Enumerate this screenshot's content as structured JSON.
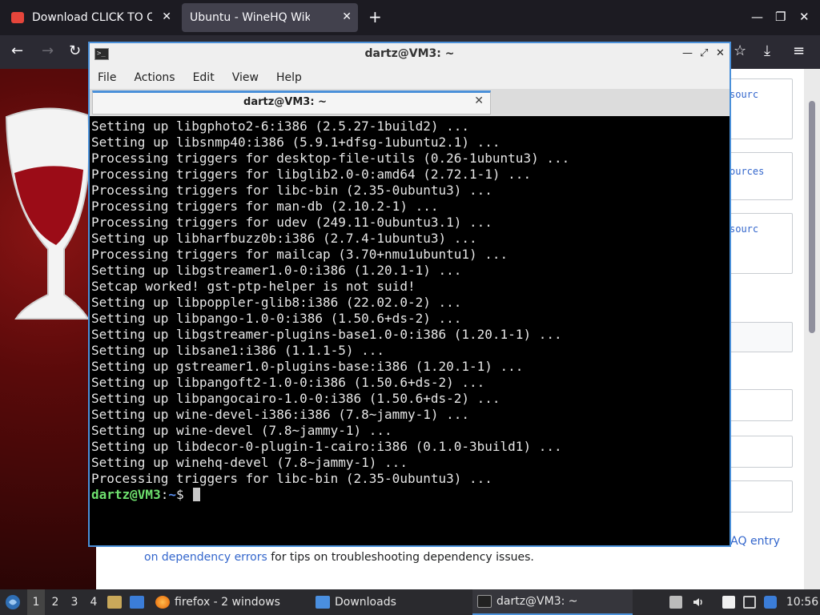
{
  "browser": {
    "tabs": [
      {
        "title": "Download CLICK TO CON",
        "active": false
      },
      {
        "title": "Ubuntu - WineHQ Wiki",
        "active": true
      }
    ],
    "new_tab": "+",
    "controls": {
      "minimize": "—",
      "maximize": "❐",
      "close": "✕"
    },
    "nav": {
      "back": "←",
      "forward": "→",
      "reload": "↻",
      "bookmark": "☆",
      "downloads": "⤓",
      "menu": "≡"
    }
  },
  "wiki": {
    "links": [
      "sourc",
      "ources",
      "sourc"
    ],
    "footer_text_pre": "",
    "footer_link_1": "FAQ entry",
    "footer_link_2": "on dependency errors",
    "footer_text_post": " for tips on troubleshooting dependency issues."
  },
  "terminal": {
    "title": "dartz@VM3: ~",
    "title_icon": ">_",
    "controls": {
      "minimize": "—",
      "maximize": "⤢",
      "close": "✕"
    },
    "menu": [
      "File",
      "Actions",
      "Edit",
      "View",
      "Help"
    ],
    "tab_label": "dartz@VM3: ~",
    "tab_close": "✕",
    "lines": [
      "Setting up libgphoto2-6:i386 (2.5.27-1build2) ...",
      "Setting up libsnmp40:i386 (5.9.1+dfsg-1ubuntu2.1) ...",
      "Processing triggers for desktop-file-utils (0.26-1ubuntu3) ...",
      "Processing triggers for libglib2.0-0:amd64 (2.72.1-1) ...",
      "Processing triggers for libc-bin (2.35-0ubuntu3) ...",
      "Processing triggers for man-db (2.10.2-1) ...",
      "Processing triggers for udev (249.11-0ubuntu3.1) ...",
      "Setting up libharfbuzz0b:i386 (2.7.4-1ubuntu3) ...",
      "Processing triggers for mailcap (3.70+nmu1ubuntu1) ...",
      "Setting up libgstreamer1.0-0:i386 (1.20.1-1) ...",
      "Setcap worked! gst-ptp-helper is not suid!",
      "Setting up libpoppler-glib8:i386 (22.02.0-2) ...",
      "Setting up libpango-1.0-0:i386 (1.50.6+ds-2) ...",
      "Setting up libgstreamer-plugins-base1.0-0:i386 (1.20.1-1) ...",
      "Setting up libsane1:i386 (1.1.1-5) ...",
      "Setting up gstreamer1.0-plugins-base:i386 (1.20.1-1) ...",
      "Setting up libpangoft2-1.0-0:i386 (1.50.6+ds-2) ...",
      "Setting up libpangocairo-1.0-0:i386 (1.50.6+ds-2) ...",
      "Setting up wine-devel-i386:i386 (7.8~jammy-1) ...",
      "Setting up wine-devel (7.8~jammy-1) ...",
      "Setting up libdecor-0-plugin-1-cairo:i386 (0.1.0-3build1) ...",
      "Setting up winehq-devel (7.8~jammy-1) ...",
      "Processing triggers for libc-bin (2.35-0ubuntu3) ..."
    ],
    "prompt_user": "dartz@VM3",
    "prompt_sep": ":",
    "prompt_path": "~",
    "prompt_sym": "$ "
  },
  "taskbar": {
    "workspaces": [
      "1",
      "2",
      "3",
      "4"
    ],
    "tasks": [
      {
        "label": "firefox - 2 windows",
        "icon": "firefox-icon"
      },
      {
        "label": "Downloads",
        "icon": "folder-icon"
      },
      {
        "label": "dartz@VM3: ~",
        "icon": "terminal-icon"
      }
    ],
    "clock": "10:56"
  }
}
